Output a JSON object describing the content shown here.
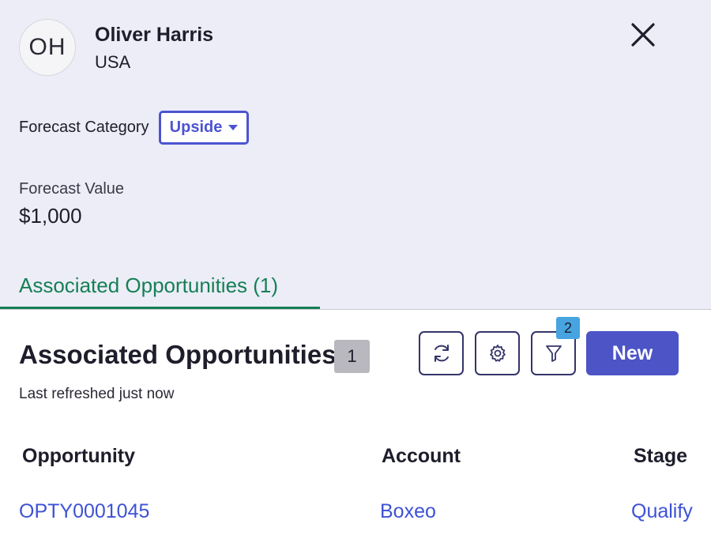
{
  "contact": {
    "initials": "OH",
    "name": "Oliver Harris",
    "country": "USA"
  },
  "icons": {
    "close": "close-icon",
    "refresh": "refresh-icon",
    "settings": "gear-icon",
    "filter": "filter-icon",
    "dropdown": "caret-down-icon"
  },
  "forecast": {
    "category_label": "Forecast Category",
    "category_value": "Upside",
    "value_label": "Forecast Value",
    "value": "$1,000"
  },
  "tabs": [
    {
      "label": "Associated Opportunities (1)",
      "active": true
    }
  ],
  "section": {
    "title": "Associated Opportunities",
    "count": "1",
    "last_refreshed": "Last refreshed just now",
    "filter_count": "2",
    "new_label": "New"
  },
  "table": {
    "columns": [
      "Opportunity",
      "Account",
      "Stage"
    ],
    "rows": [
      {
        "opportunity": "OPTY0001045",
        "account": "Boxeo",
        "stage": "Qualify"
      }
    ]
  },
  "colors": {
    "header_bg": "#ecedf7",
    "accent": "#4c54d0",
    "tab_active": "#167f55",
    "link": "#3d52d5",
    "filter_badge": "#47a4e0"
  }
}
